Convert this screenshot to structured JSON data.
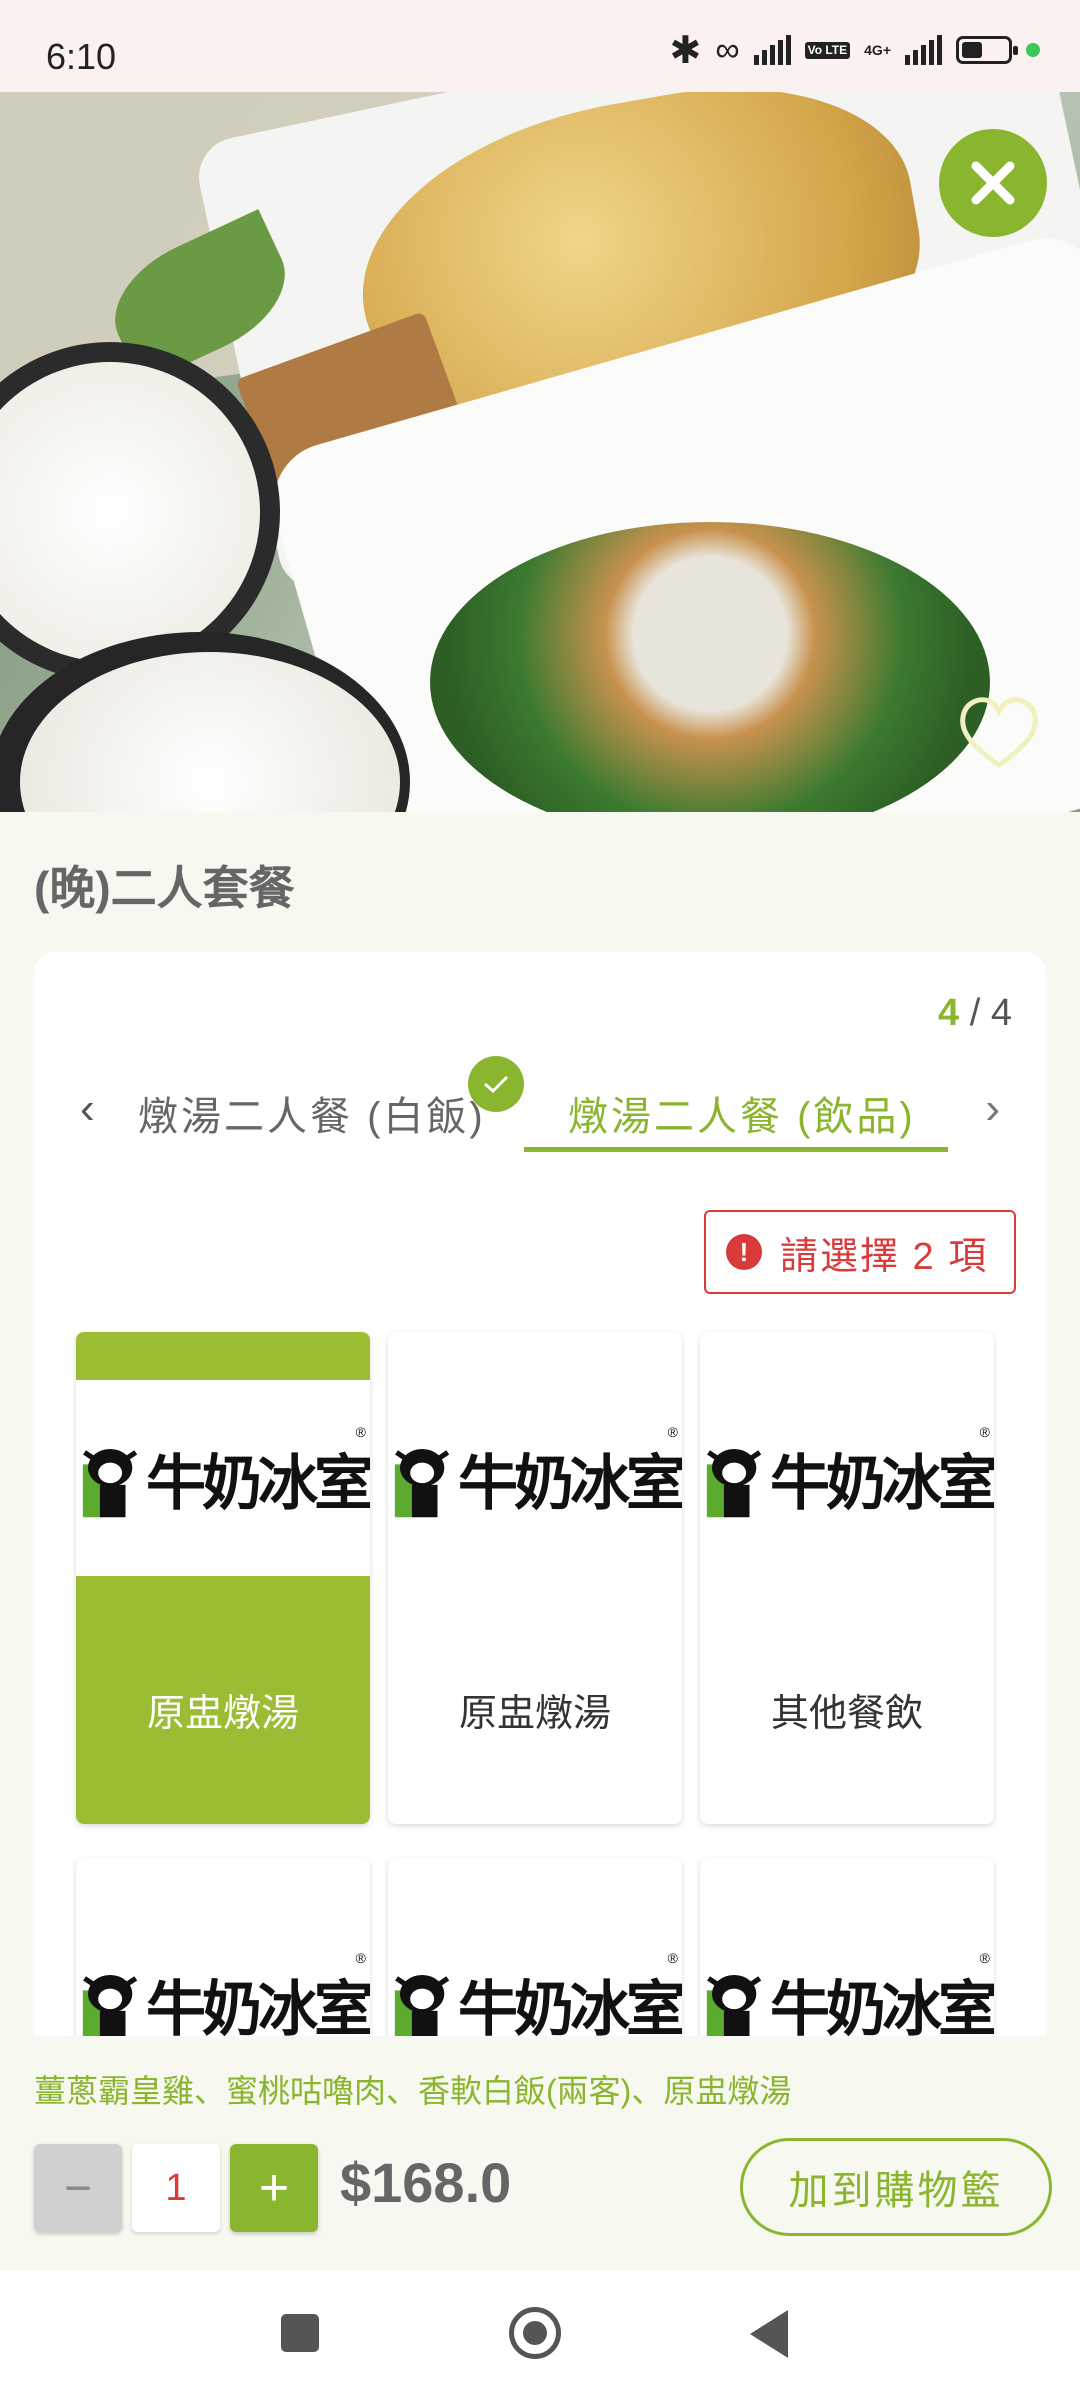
{
  "status_bar": {
    "time": "6:10",
    "network": "4G+",
    "volte": "Vo LTE",
    "battery_level": 0.45
  },
  "hero": {
    "close_icon": "close-icon",
    "favorite_icon": "heart-outline-icon"
  },
  "product": {
    "title": "(晚)二人套餐"
  },
  "steps": {
    "current": "4",
    "total": "/ 4",
    "prev_tab": "燉湯二人餐 (白飯)",
    "current_tab": "燉湯二人餐 (飲品)",
    "prev_tab_completed": true
  },
  "validation": {
    "message": "請選擇 2 項",
    "color": "#d93a3a"
  },
  "options": [
    {
      "brand": "牛奶冰室",
      "label": "原盅燉湯",
      "selected": true
    },
    {
      "brand": "牛奶冰室",
      "label": "原盅燉湯",
      "selected": false
    },
    {
      "brand": "牛奶冰室",
      "label": "其他餐飲",
      "selected": false
    },
    {
      "brand": "牛奶冰室",
      "label": "",
      "selected": false
    },
    {
      "brand": "牛奶冰室",
      "label": "",
      "selected": false
    },
    {
      "brand": "牛奶冰室",
      "label": "",
      "selected": false
    }
  ],
  "cart": {
    "summary": "薑蔥霸皇雞、蜜桃咕嚕肉、香軟白飯(兩客)、原盅燉湯",
    "quantity": "1",
    "minus_label": "−",
    "plus_label": "+",
    "price": "$168.0",
    "add_button": "加到購物籃"
  },
  "theme": {
    "accent": "#8ab52e",
    "error": "#d93a3a"
  }
}
